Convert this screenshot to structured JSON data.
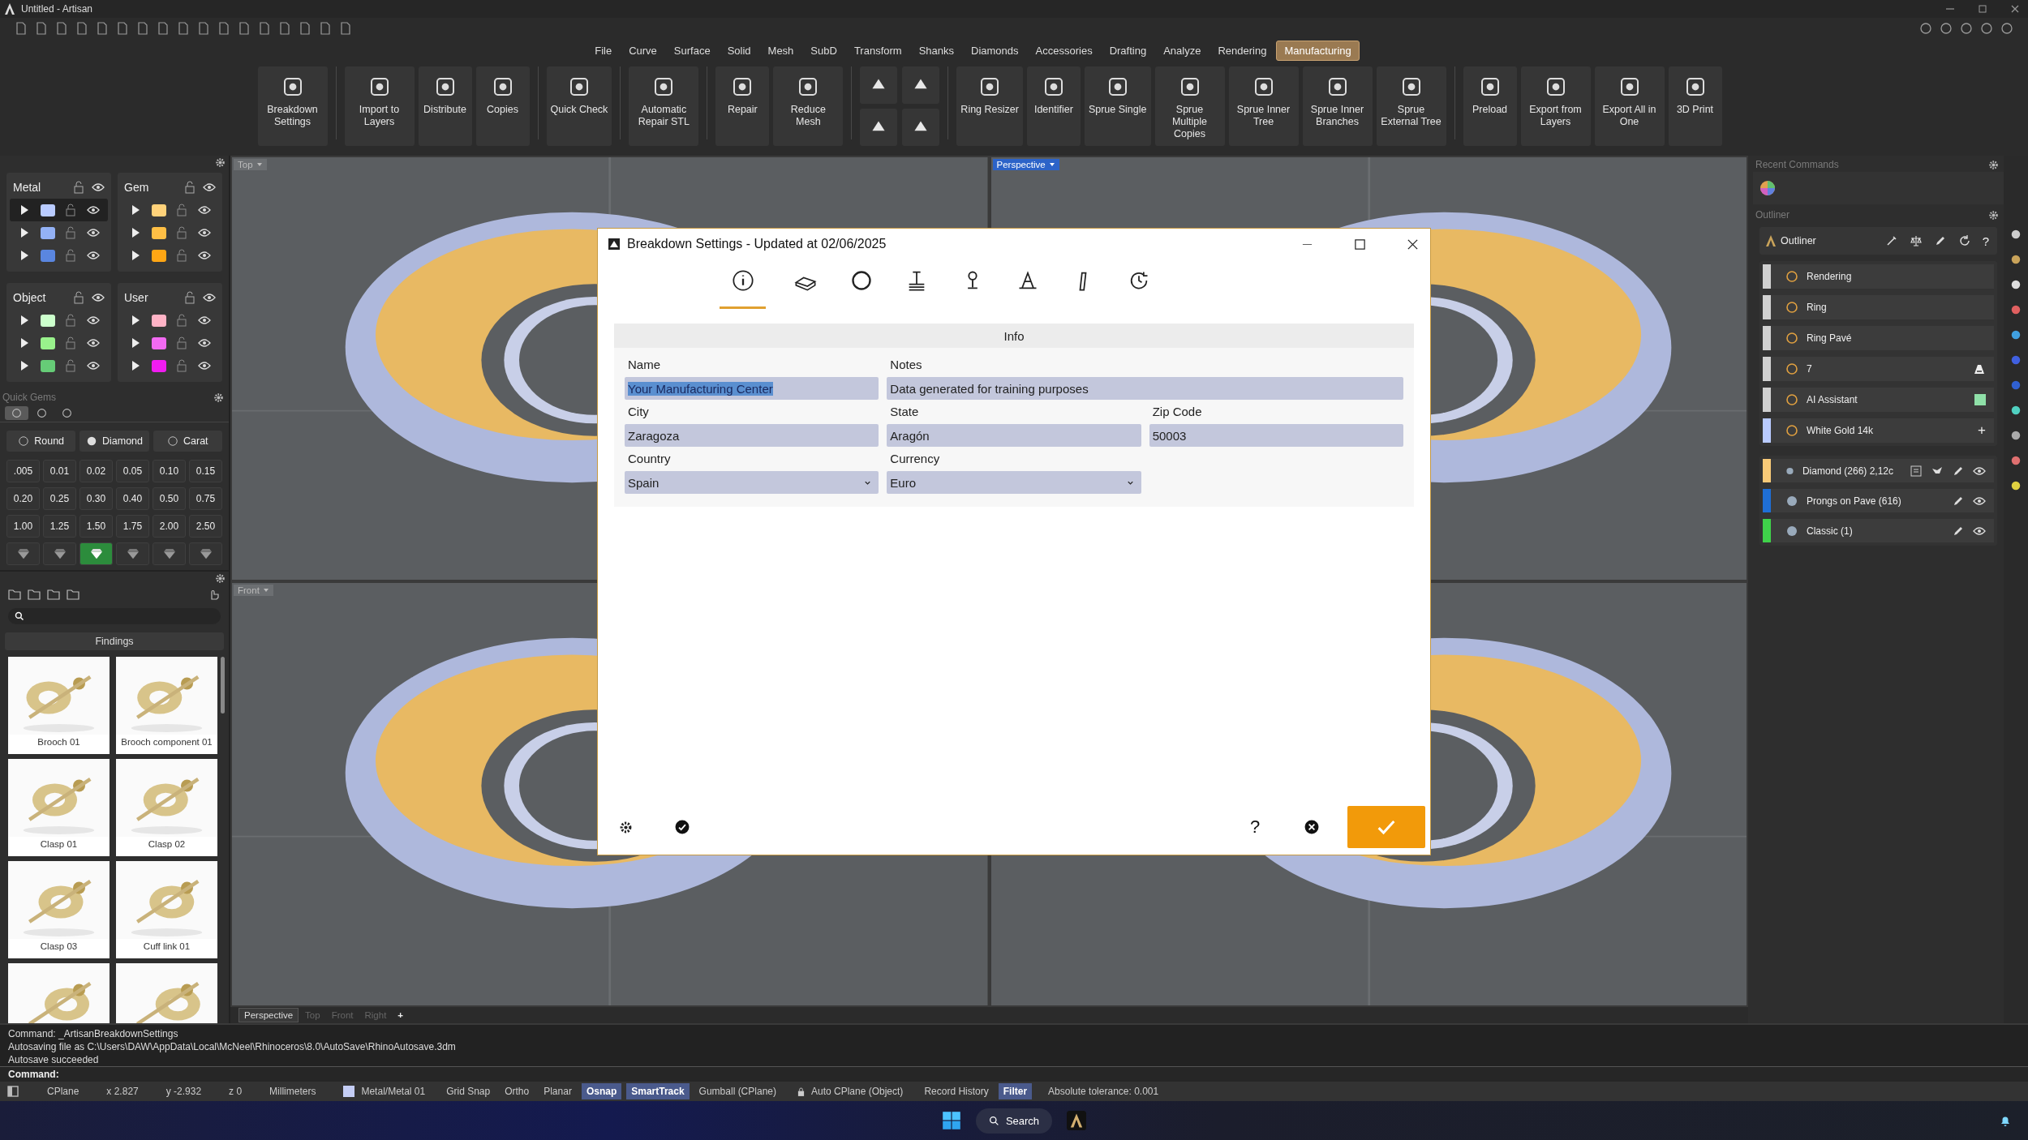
{
  "window": {
    "title": "Untitled - Artisan"
  },
  "menu": [
    {
      "label": "File",
      "selected": false
    },
    {
      "label": "Curve",
      "selected": false
    },
    {
      "label": "Surface",
      "selected": false
    },
    {
      "label": "Solid",
      "selected": false
    },
    {
      "label": "Mesh",
      "selected": false
    },
    {
      "label": "SubD",
      "selected": false
    },
    {
      "label": "Transform",
      "selected": false
    },
    {
      "label": "Shanks",
      "selected": false
    },
    {
      "label": "Diamonds",
      "selected": false
    },
    {
      "label": "Accessories",
      "selected": false
    },
    {
      "label": "Drafting",
      "selected": false
    },
    {
      "label": "Analyze",
      "selected": false
    },
    {
      "label": "Rendering",
      "selected": false
    },
    {
      "label": "Manufacturing",
      "selected": true
    }
  ],
  "ribbon": [
    {
      "kind": "button",
      "label": "Breakdown Settings"
    },
    {
      "kind": "separator"
    },
    {
      "kind": "button",
      "label": "Import to Layers"
    },
    {
      "kind": "button",
      "label": "Distribute"
    },
    {
      "kind": "button",
      "label": "Copies"
    },
    {
      "kind": "separator"
    },
    {
      "kind": "button",
      "label": "Quick Check"
    },
    {
      "kind": "separator"
    },
    {
      "kind": "button",
      "label": "Automatic Repair STL"
    },
    {
      "kind": "separator"
    },
    {
      "kind": "button",
      "label": "Repair"
    },
    {
      "kind": "button",
      "label": "Reduce Mesh"
    },
    {
      "kind": "separator"
    },
    {
      "kind": "small"
    },
    {
      "kind": "separator"
    },
    {
      "kind": "button",
      "label": "Ring Resizer"
    },
    {
      "kind": "button",
      "label": "Identifier"
    },
    {
      "kind": "button",
      "label": "Sprue Single"
    },
    {
      "kind": "button",
      "label": "Sprue Multiple Copies"
    },
    {
      "kind": "button",
      "label": "Sprue Inner Tree"
    },
    {
      "kind": "button",
      "label": "Sprue Inner Branches"
    },
    {
      "kind": "button",
      "label": "Sprue External Tree"
    },
    {
      "kind": "separator"
    },
    {
      "kind": "button",
      "label": "Preload"
    },
    {
      "kind": "button",
      "label": "Export from Layers"
    },
    {
      "kind": "button",
      "label": "Export All in One"
    },
    {
      "kind": "button",
      "label": "3D Print"
    }
  ],
  "layers": [
    {
      "name": "Metal",
      "rows": [
        {
          "color": "#b9cbff",
          "selected": true
        },
        {
          "color": "#93b1f5",
          "selected": false
        },
        {
          "color": "#5a86e0",
          "selected": false
        }
      ]
    },
    {
      "name": "Gem",
      "rows": [
        {
          "color": "#ffd27a",
          "selected": false
        },
        {
          "color": "#ffbf45",
          "selected": false
        },
        {
          "color": "#ffa614",
          "selected": false
        }
      ]
    },
    {
      "name": "Object",
      "rows": [
        {
          "color": "#ccffcc",
          "selected": false
        },
        {
          "color": "#99f28c",
          "selected": false
        },
        {
          "color": "#66cc77",
          "selected": false
        }
      ]
    },
    {
      "name": "User",
      "rows": [
        {
          "color": "#ffb3c6",
          "selected": false
        },
        {
          "color": "#f26af2",
          "selected": false
        },
        {
          "color": "#f01cf0",
          "selected": false
        }
      ]
    }
  ],
  "quick_gems": {
    "title": "Quick Gems",
    "tabs": [
      {
        "selected": true
      },
      {
        "selected": false
      },
      {
        "selected": false
      }
    ],
    "shape": "Round",
    "material": "Diamond",
    "unit": "Carat",
    "sizes": [
      ".005",
      "0.01",
      "0.02",
      "0.05",
      "0.10",
      "0.15",
      "0.20",
      "0.25",
      "0.30",
      "0.40",
      "0.50",
      "0.75",
      "1.00",
      "1.25",
      "1.50",
      "1.75",
      "2.00",
      "2.50"
    ],
    "cuts": [
      {
        "selected": false
      },
      {
        "selected": false
      },
      {
        "selected": true
      },
      {
        "selected": false
      },
      {
        "selected": false
      },
      {
        "selected": false
      }
    ]
  },
  "library": {
    "category": "Findings",
    "items": [
      {
        "kind": "thumbnail",
        "label": "Brooch 01"
      },
      {
        "kind": "thumbnail",
        "label": "Brooch component 01"
      },
      {
        "kind": "thumbnail",
        "label": "Clasp 01"
      },
      {
        "kind": "thumbnail",
        "label": "Clasp 02"
      },
      {
        "kind": "thumbnail",
        "label": "Clasp 03"
      },
      {
        "kind": "thumbnail",
        "label": "Cuff link 01"
      },
      {
        "kind": "picture"
      },
      {
        "kind": "picture"
      }
    ]
  },
  "viewports": [
    {
      "label": "Top",
      "selected": false
    },
    {
      "label": "Perspective",
      "selected": true
    },
    {
      "label": "Front",
      "selected": false
    }
  ],
  "view_tabs": [
    {
      "label": "Perspective",
      "selected": true
    },
    {
      "label": "Top",
      "selected": false
    },
    {
      "label": "Front",
      "selected": false
    },
    {
      "label": "Right",
      "selected": false
    }
  ],
  "view_add": "+",
  "right_panel": {
    "recent_title": "Recent Commands",
    "outliner_title": "Outliner",
    "header": "Outliner",
    "help": "?",
    "items": [
      {
        "label": "Rendering",
        "color": "#d0d0d0",
        "kind": "plain"
      },
      {
        "label": "Ring",
        "color": "#d0d0d0",
        "kind": "plain"
      },
      {
        "label": "Ring Pavé",
        "color": "#d0d0d0",
        "kind": "plain"
      },
      {
        "label": "7",
        "color": "#d0d0d0",
        "kind": "hat"
      },
      {
        "label": "AI Assistant",
        "color": "#d0d0d0",
        "kind": "swatch"
      },
      {
        "label": "White Gold 14k",
        "color": "#b9cbff",
        "kind": "add",
        "add": "+"
      }
    ],
    "objects": [
      {
        "label": "Diamond (266) 2,12c",
        "color": "#f7c977",
        "kind": "full"
      },
      {
        "label": "Prongs on Pave (616)",
        "color": "#1f6fd6",
        "kind": "edit"
      },
      {
        "label": "Classic (1)",
        "color": "#3fd24a",
        "kind": "edit"
      }
    ]
  },
  "dialog": {
    "title": "Breakdown Settings - Updated at 02/06/2025",
    "tabs": [
      {
        "selected": true
      },
      {
        "selected": false
      },
      {
        "selected": false
      },
      {
        "selected": false
      },
      {
        "selected": false
      },
      {
        "selected": false
      },
      {
        "selected": false
      },
      {
        "selected": false
      }
    ],
    "section": "Info",
    "help": "?",
    "fields": [
      {
        "label": "Name",
        "value": "Your Manufacturing Center",
        "kind": "text",
        "highlighted": true
      },
      {
        "label": "Notes",
        "value": "Data generated for training purposes",
        "kind": "wide",
        "highlighted": false
      },
      {
        "label": "City",
        "value": "Zaragoza",
        "kind": "text",
        "highlighted": false
      },
      {
        "label": "State",
        "value": "Aragón",
        "kind": "text",
        "highlighted": false
      },
      {
        "label": "Zip Code",
        "value": "50003",
        "kind": "text",
        "highlighted": false
      },
      {
        "label": "Country",
        "value": "Spain",
        "kind": "select",
        "highlighted": false
      },
      {
        "label": "Currency",
        "value": "Euro",
        "kind": "select",
        "highlighted": false
      }
    ]
  },
  "command": {
    "history": [
      "Command: _ArtisanBreakdownSettings",
      "Autosaving file as C:\\Users\\DAW\\AppData\\Local\\McNeel\\Rhinoceros\\8.0\\AutoSave\\RhinoAutosave.3dm",
      "Autosave succeeded"
    ],
    "prompt": "Command:"
  },
  "status": [
    {
      "kind": "info",
      "label": "CPlane"
    },
    {
      "kind": "info",
      "label": "x 2.827"
    },
    {
      "kind": "info",
      "label": "y -2.932"
    },
    {
      "kind": "info",
      "label": "z 0"
    },
    {
      "kind": "info",
      "label": "Millimeters"
    },
    {
      "kind": "layer",
      "label": "Metal/Metal 01",
      "color": "#c4cdf5"
    },
    {
      "kind": "toggle",
      "label": "Grid Snap",
      "on": false
    },
    {
      "kind": "toggle",
      "label": "Ortho",
      "on": false
    },
    {
      "kind": "toggle",
      "label": "Planar",
      "on": false
    },
    {
      "kind": "toggle",
      "label": "Osnap",
      "on": true
    },
    {
      "kind": "toggle",
      "label": "SmartTrack",
      "on": true
    },
    {
      "kind": "toggle",
      "label": "Gumball (CPlane)",
      "on": false
    },
    {
      "kind": "lock",
      "label": "Auto CPlane (Object)"
    },
    {
      "kind": "toggle",
      "label": "Record History",
      "on": false
    },
    {
      "kind": "toggle",
      "label": "Filter",
      "on": true
    },
    {
      "kind": "info",
      "label": "Absolute tolerance: 0.001"
    }
  ],
  "taskbar": {
    "search": "Search"
  }
}
